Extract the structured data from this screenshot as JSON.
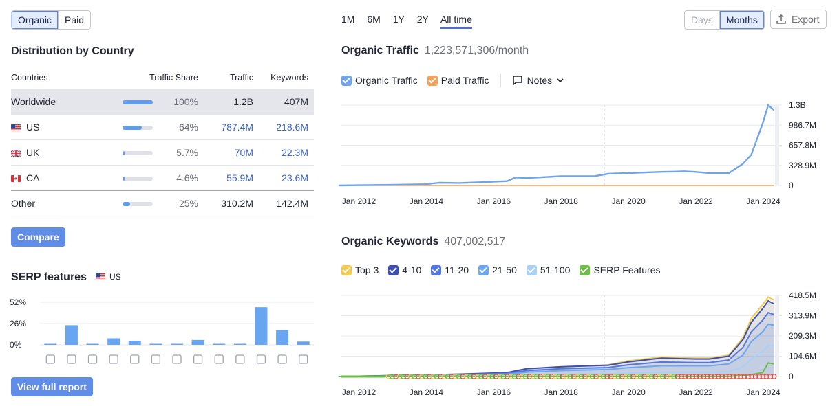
{
  "source_toggle": {
    "options": [
      "Organic",
      "Paid"
    ],
    "active": "Organic"
  },
  "distribution": {
    "title": "Distribution by Country",
    "columns": [
      "Countries",
      "Traffic Share",
      "Traffic",
      "Keywords"
    ],
    "rows": [
      {
        "country": "Worldwide",
        "share": "100%",
        "share_value": 1.0,
        "traffic": "1.2B",
        "keywords": "407M"
      },
      {
        "country": "US",
        "share": "64%",
        "share_value": 0.64,
        "traffic": "787.4M",
        "keywords": "218.6M"
      },
      {
        "country": "UK",
        "share": "5.7%",
        "share_value": 0.057,
        "traffic": "70M",
        "keywords": "22.3M"
      },
      {
        "country": "CA",
        "share": "4.6%",
        "share_value": 0.046,
        "traffic": "55.9M",
        "keywords": "23.6M"
      },
      {
        "country": "Other",
        "share": "25%",
        "share_value": 0.25,
        "traffic": "310.2M",
        "keywords": "142.4M"
      }
    ],
    "compare_label": "Compare"
  },
  "serp": {
    "title": "SERP features",
    "country": "US",
    "yticks": [
      "52%",
      "26%",
      "0%"
    ],
    "values": [
      1,
      24,
      1,
      8,
      5,
      1,
      1,
      6,
      1,
      1,
      46,
      18,
      4
    ],
    "icons": [
      "crown-icon",
      "link-icon",
      "diamond-icon",
      "image-icon",
      "images-icon",
      "play-icon",
      "play-circle-icon",
      "review-icon",
      "graduation-icon",
      "checklist-icon",
      "comment-icon",
      "book-icon",
      "list-icon"
    ],
    "full_report_label": "View full report"
  },
  "periods": {
    "options": [
      "1M",
      "6M",
      "1Y",
      "2Y",
      "All time"
    ],
    "active": "All time"
  },
  "granularity": {
    "options": [
      "Days",
      "Months"
    ],
    "active": "Months"
  },
  "export_label": "Export",
  "traffic": {
    "title": "Organic Traffic",
    "value": "1,223,571,306/month",
    "legend": [
      {
        "label": "Organic Traffic",
        "color": "#6fa4e8"
      },
      {
        "label": "Paid Traffic",
        "color": "#f1a25a"
      }
    ],
    "notes_label": "Notes",
    "yticks": [
      "1.3B",
      "986.7M",
      "657.8M",
      "328.9M",
      "0"
    ],
    "xticks": [
      "Jan 2012",
      "Jan 2014",
      "Jan 2016",
      "Jan 2018",
      "Jan 2020",
      "Jan 2022",
      "Jan 2024"
    ]
  },
  "keywords": {
    "title": "Organic Keywords",
    "value": "407,002,517",
    "legend": [
      {
        "label": "Top 3",
        "color": "#f2c94c"
      },
      {
        "label": "4-10",
        "color": "#3b4fb0"
      },
      {
        "label": "11-20",
        "color": "#5277e0"
      },
      {
        "label": "21-50",
        "color": "#6aa7f0"
      },
      {
        "label": "51-100",
        "color": "#a9d0f8"
      },
      {
        "label": "SERP Features",
        "color": "#6cbd45"
      }
    ],
    "yticks": [
      "418.5M",
      "313.9M",
      "209.3M",
      "104.6M",
      "0"
    ],
    "xticks": [
      "Jan 2012",
      "Jan 2014",
      "Jan 2016",
      "Jan 2018",
      "Jan 2020",
      "Jan 2022",
      "Jan 2024"
    ]
  },
  "chart_data": [
    {
      "type": "line",
      "x": [
        "2011-06",
        "2012-01",
        "2013-01",
        "2014-01",
        "2014-06",
        "2015-01",
        "2016-01",
        "2016-06",
        "2016-09",
        "2017-01",
        "2018-01",
        "2019-01",
        "2019-06",
        "2020-01",
        "2021-01",
        "2021-06",
        "2021-09",
        "2022-01",
        "2022-06",
        "2023-01",
        "2023-06",
        "2023-09",
        "2024-01",
        "2024-03",
        "2024-05"
      ],
      "series": [
        {
          "name": "Organic Traffic",
          "values": [
            0,
            5,
            10,
            20,
            45,
            40,
            60,
            70,
            130,
            120,
            150,
            150,
            190,
            200,
            220,
            225,
            230,
            220,
            200,
            200,
            350,
            500,
            1000,
            1300,
            1220
          ]
        },
        {
          "name": "Paid Traffic",
          "values": [
            0,
            0,
            0,
            0,
            0,
            0,
            0,
            0,
            0,
            0,
            0,
            0,
            0,
            0,
            0,
            0,
            0,
            0,
            0,
            0,
            0,
            0,
            0,
            0,
            0
          ]
        }
      ],
      "ylim": [
        0,
        1300
      ],
      "yunit": "M"
    },
    {
      "type": "area",
      "x": [
        "2011-06",
        "2013-01",
        "2015-01",
        "2016-06",
        "2017-01",
        "2018-01",
        "2019-06",
        "2020-01",
        "2021-01",
        "2022-01",
        "2022-06",
        "2023-01",
        "2023-06",
        "2023-09",
        "2024-01",
        "2024-03",
        "2024-05"
      ],
      "series": [
        {
          "name": "Top 3",
          "values": [
            0,
            5,
            12,
            20,
            40,
            50,
            60,
            80,
            100,
            95,
            95,
            110,
            200,
            300,
            370,
            410,
            395
          ]
        },
        {
          "name": "4-10",
          "values": [
            0,
            5,
            12,
            20,
            40,
            50,
            58,
            75,
            95,
            90,
            90,
            105,
            190,
            280,
            350,
            390,
            375
          ]
        },
        {
          "name": "11-20",
          "values": [
            0,
            4,
            10,
            16,
            30,
            40,
            46,
            60,
            75,
            72,
            72,
            85,
            150,
            230,
            290,
            330,
            320
          ]
        },
        {
          "name": "21-50",
          "values": [
            0,
            3,
            8,
            12,
            22,
            30,
            36,
            45,
            55,
            55,
            55,
            65,
            110,
            180,
            230,
            270,
            265
          ]
        },
        {
          "name": "51-100",
          "values": [
            0,
            1,
            3,
            5,
            8,
            12,
            14,
            18,
            22,
            22,
            22,
            26,
            50,
            90,
            130,
            160,
            160
          ]
        },
        {
          "name": "SERP Features",
          "values": [
            0,
            0,
            0,
            0,
            0,
            0,
            0,
            0,
            0,
            0,
            0,
            0,
            5,
            10,
            20,
            70,
            65
          ]
        }
      ],
      "ylim": [
        0,
        418.5
      ],
      "yunit": "M"
    }
  ]
}
